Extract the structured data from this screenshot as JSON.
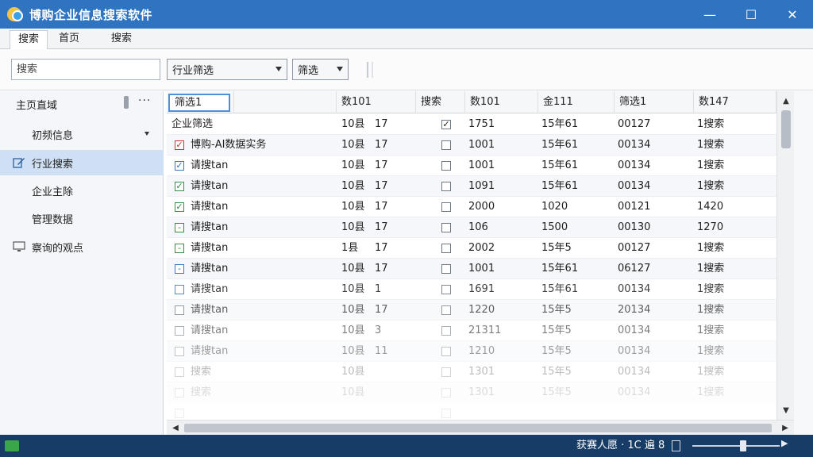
{
  "window": {
    "title": "博购企业信息搜索软件",
    "controls": {
      "minimize": "—",
      "maximize": "☐",
      "close": "✕"
    }
  },
  "tabs": [
    {
      "label": "搜索",
      "active": true
    },
    {
      "label": "首页",
      "active": false
    },
    {
      "label": "搜索",
      "active": false
    }
  ],
  "toolbar": {
    "search_placeholder": "搜索",
    "industry_filter": "行业筛选",
    "sort_filter": "筛选"
  },
  "sidebar": {
    "items": [
      {
        "label": "主页直域"
      },
      {
        "label": "初频信息"
      },
      {
        "label": "行业搜索",
        "selected": true
      },
      {
        "label": "企业主除"
      },
      {
        "label": "管理数据"
      },
      {
        "label": "察询的观点"
      }
    ],
    "more": "···"
  },
  "grid": {
    "columns": [
      "筛选1",
      "",
      "数101",
      "搜索",
      "数101",
      "金111",
      "筛选1",
      "数147"
    ],
    "rows": [
      {
        "c0": "企业筛选",
        "c2": "10县",
        "c3": "17",
        "check": "header",
        "c5": "1751",
        "c6": "15年61",
        "c7": "00127",
        "c8": "1搜索"
      },
      {
        "c0": "博购-AI数据实务",
        "c2": "10县",
        "c3": "17",
        "check": "red",
        "c5": "1001",
        "c6": "15年61",
        "c7": "00134",
        "c8": "1搜索"
      },
      {
        "c0": "请搜tan",
        "c2": "10县",
        "c3": "17",
        "check": "blue",
        "c5": "1001",
        "c6": "15年61",
        "c7": "00134",
        "c8": "1搜索"
      },
      {
        "c0": "请搜tan",
        "c2": "10县",
        "c3": "17",
        "check": "green",
        "c5": "1091",
        "c6": "15年61",
        "c7": "00134",
        "c8": "1搜索"
      },
      {
        "c0": "请搜tan",
        "c2": "10县",
        "c3": "17",
        "check": "green",
        "c5": "2000",
        "c6": "1020",
        "c7": "00121",
        "c8": "1420"
      },
      {
        "c0": "请搜tan",
        "c2": "10县",
        "c3": "17",
        "check": "green-dash",
        "c5": "106",
        "c6": "1500",
        "c7": "00130",
        "c8": "1270"
      },
      {
        "c0": "请搜tan",
        "c2": "1县",
        "c3": "17",
        "check": "green-dash",
        "c5": "2002",
        "c6": "15年5",
        "c7": "00127",
        "c8": "1搜索"
      },
      {
        "c0": "请搜tan",
        "c2": "10县",
        "c3": "17",
        "check": "blue-dash",
        "c5": "1001",
        "c6": "15年61",
        "c7": "06127",
        "c8": "1搜索"
      },
      {
        "c0": "请搜tan",
        "c2": "10县",
        "c3": "1",
        "check": "blue-empty",
        "c5": "1691",
        "c6": "15年61",
        "c7": "00134",
        "c8": "1搜索"
      },
      {
        "c0": "请搜tan",
        "c2": "10县",
        "c3": "17",
        "check": "empty",
        "c5": "1220",
        "c6": "15年5",
        "c7": "20134",
        "c8": "1搜索"
      },
      {
        "c0": "请搜tan",
        "c2": "10县",
        "c3": "3",
        "check": "empty",
        "c5": "21311",
        "c6": "15年5",
        "c7": "00134",
        "c8": "1搜索"
      },
      {
        "c0": "请搜tan",
        "c2": "10县",
        "c3": "11",
        "check": "empty",
        "c5": "1210",
        "c6": "15年5",
        "c7": "00134",
        "c8": "1搜索"
      },
      {
        "c0": "搜索",
        "c2": "10县",
        "c3": "",
        "check": "empty",
        "c5": "1301",
        "c6": "15年5",
        "c7": "00134",
        "c8": "1搜索"
      },
      {
        "c0": "搜索",
        "c2": "10县",
        "c3": "",
        "check": "empty",
        "c5": "1301",
        "c6": "15年5",
        "c7": "00134",
        "c8": "1搜索"
      },
      {
        "c0": "",
        "c2": "",
        "c3": "",
        "check": "empty",
        "c5": "",
        "c6": "",
        "c7": "",
        "c8": ""
      }
    ]
  },
  "statusbar": {
    "text": "获赛人愿 · 1C 遍 8"
  },
  "colors": {
    "titlebar": "#2f74c0",
    "statusbar": "#173c66",
    "selection": "#cfe0f4",
    "accent": "#4d90d6"
  }
}
